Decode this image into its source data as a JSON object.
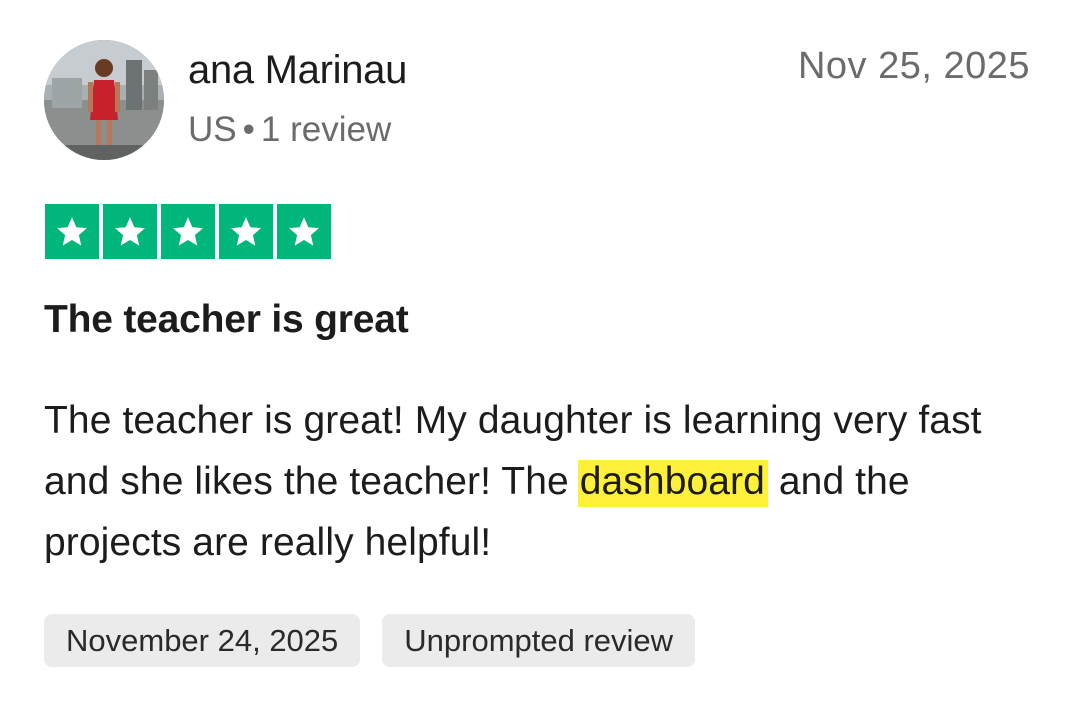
{
  "reviewer": {
    "name": "ana Marinau",
    "country": "US",
    "separator": "•",
    "review_count": "1 review",
    "avatar_icon": "profile-photo"
  },
  "review": {
    "date": "Nov 25, 2025",
    "rating": 5,
    "rating_max": 5,
    "star_color": "#00b67a",
    "title": "The teacher is great",
    "body_before": "The teacher is great! My daughter is learning very fast and she likes the teacher! The ",
    "body_highlight": "dashboard",
    "body_after": " and the projects are really helpful!",
    "highlight_color": "#fff03a"
  },
  "tags": {
    "experience_date": "November 24, 2025",
    "review_type": "Unprompted review"
  }
}
